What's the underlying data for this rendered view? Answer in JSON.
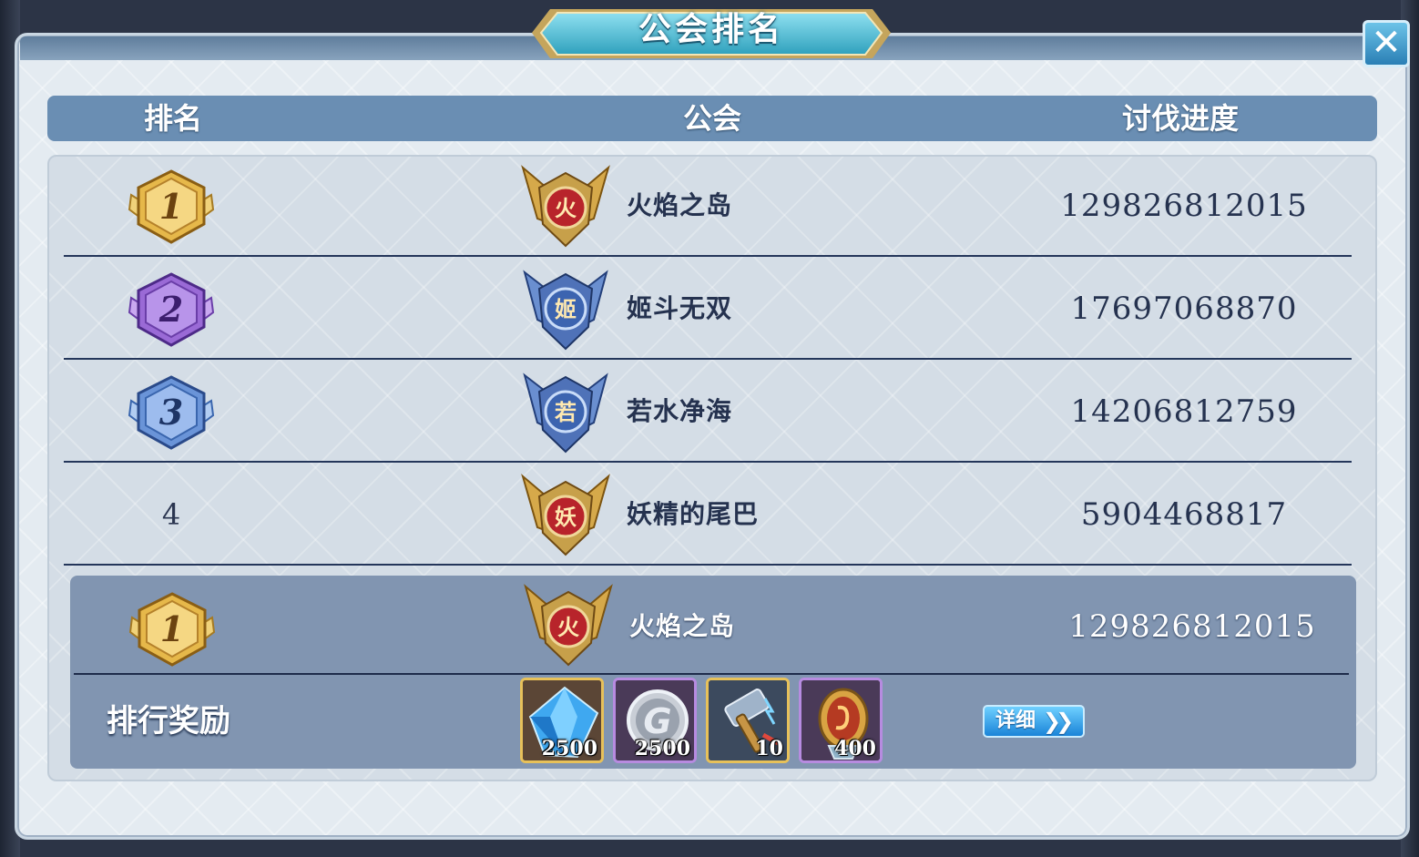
{
  "window": {
    "title": "公会排名",
    "close_glyph": "✕"
  },
  "table": {
    "headers": {
      "rank": "排名",
      "guild": "公会",
      "progress": "讨伐进度"
    },
    "rows": [
      {
        "rank": "1",
        "emblem_char": "火",
        "emblem_color": "#b8242b",
        "name": "火焰之岛",
        "progress": "129826812015"
      },
      {
        "rank": "2",
        "emblem_char": "姬",
        "emblem_color": "#3c64b0",
        "name": "姬斗无双",
        "progress": "17697068870"
      },
      {
        "rank": "3",
        "emblem_char": "若",
        "emblem_color": "#3c64b0",
        "name": "若水净海",
        "progress": "14206812759"
      },
      {
        "rank": "4",
        "emblem_char": "妖",
        "emblem_color": "#b8242b",
        "name": "妖精的尾巴",
        "progress": "5904468817"
      }
    ]
  },
  "my_guild": {
    "rank": "1",
    "emblem_char": "火",
    "name": "火焰之岛",
    "progress": "129826812015",
    "reward_label": "排行奖励",
    "rewards": [
      {
        "icon": "blue-crystal-icon",
        "count": "2500"
      },
      {
        "icon": "silver-coin-icon",
        "count": "2500"
      },
      {
        "icon": "hammer-icon",
        "count": "10"
      },
      {
        "icon": "gem-badge-icon",
        "count": "400"
      }
    ],
    "detail_label": "详细",
    "detail_chevrons": "❯❯"
  },
  "colors": {
    "header_bg": "#6a8eb3",
    "my_row_bg": "#8195b1",
    "rank1": "#e6b84a",
    "rank2": "#9a6ad6",
    "rank3": "#6a94d8"
  }
}
